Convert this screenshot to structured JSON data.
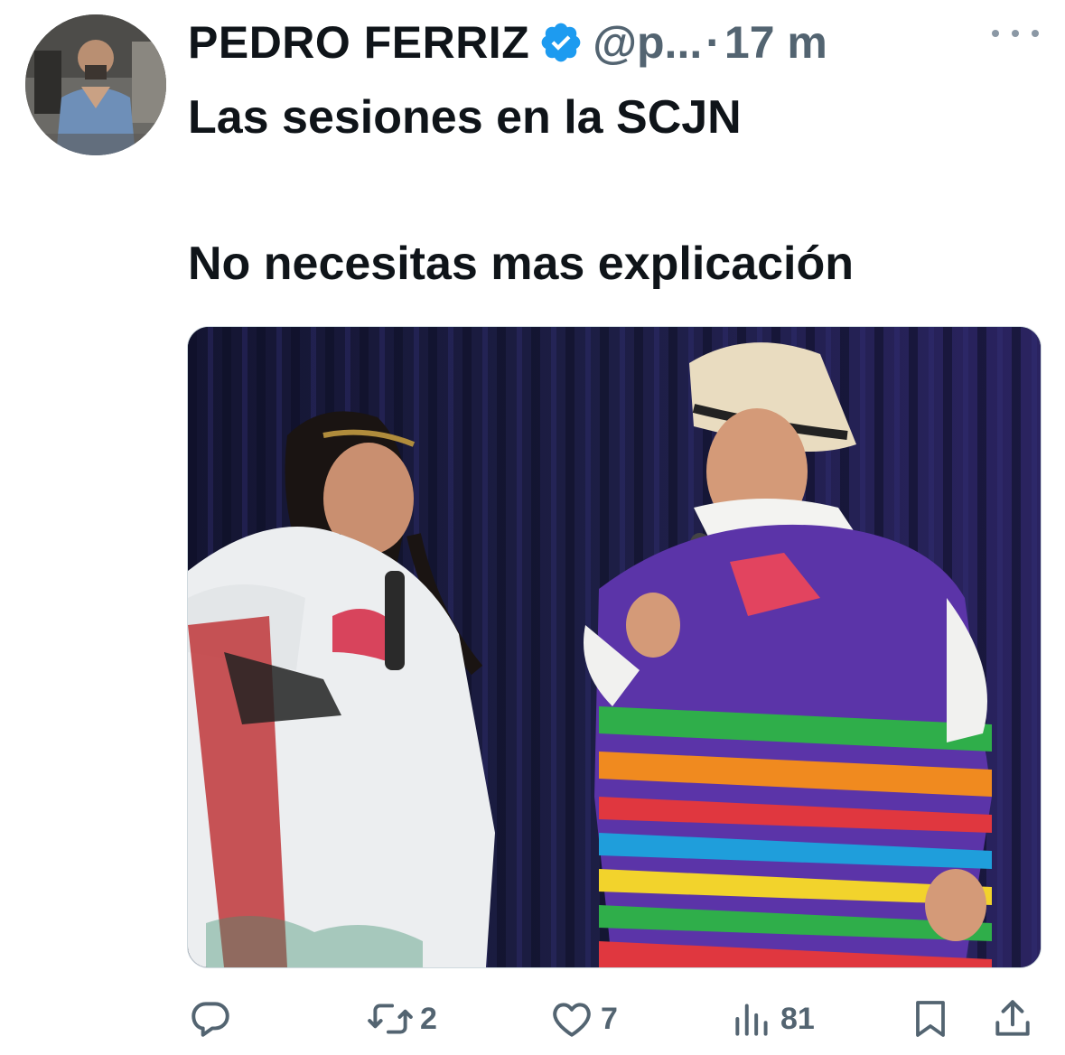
{
  "user": {
    "display_name": "PEDRO FERRIZ",
    "handle": "@p...",
    "separator": "·",
    "time": "17 m",
    "verified_color": "#1d9bf0"
  },
  "tweet": {
    "line1": "Las sesiones en la SCJN",
    "line2": "No necesitas mas explicación"
  },
  "actions": {
    "reply_count": "",
    "retweet_count": "2",
    "like_count": "7",
    "views_count": "81"
  },
  "icons": {
    "more": "more-dots-icon",
    "reply": "reply-icon",
    "retweet": "retweet-icon",
    "like": "heart-icon",
    "views": "views-chart-icon",
    "bookmark": "bookmark-icon",
    "share": "share-icon"
  },
  "colors": {
    "text": "#0f1419",
    "secondary": "#536471",
    "accent": "#1d9bf0"
  }
}
